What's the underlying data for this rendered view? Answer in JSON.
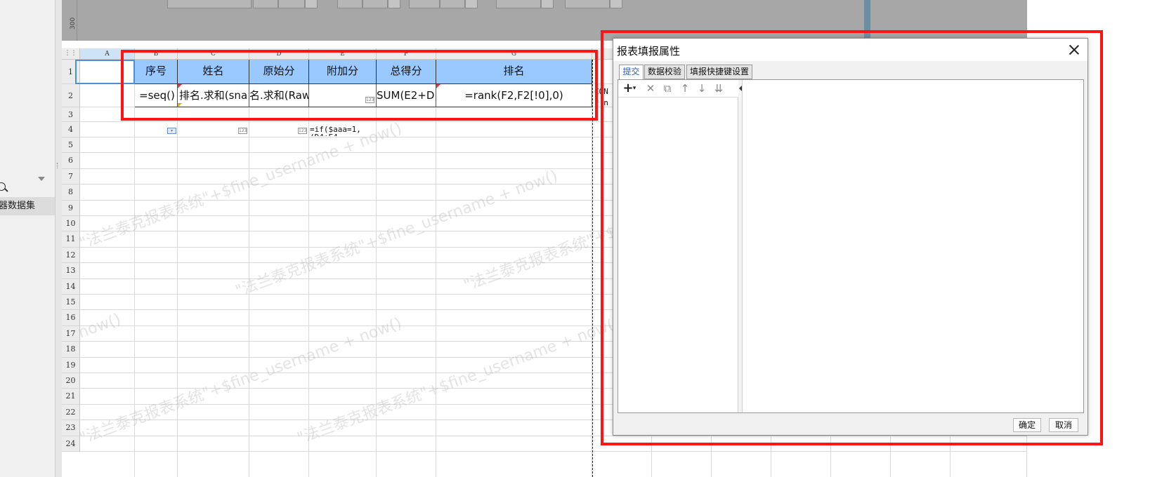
{
  "left_panel": {
    "dataset_label": "器数据集"
  },
  "toolbar_dim": {
    "ruler_label": "300"
  },
  "sheet": {
    "columns": [
      "A",
      "B",
      "C",
      "D",
      "E",
      "F",
      "G"
    ],
    "rows": [
      "1",
      "2",
      "3",
      "4",
      "5",
      "6",
      "7",
      "8",
      "9",
      "10",
      "11",
      "12",
      "13",
      "14",
      "15",
      "16",
      "17",
      "18",
      "19",
      "20",
      "21",
      "22",
      "23",
      "24"
    ],
    "header_row": [
      "序号",
      "姓名",
      "原始分",
      "附加分",
      "总得分",
      "排名"
    ],
    "formula_row": [
      "=seq()",
      "排名.求和(sna",
      "名.求和(Raw",
      "",
      "SUM(E2+D",
      "=rank(F2,F2[!0],0)"
    ],
    "row4_formula": "=if($aaa=1,",
    "row4_formula_line2": "  (D4+E4",
    "overflow_text_1": "CON",
    "overflow_text_2": "*.n",
    "cell_tag": "123",
    "watermarks": [
      "\"法兰泰克报表系统\"+$fine_username + now()",
      "\"法兰泰克报表系统\"+$fine_username + now()",
      "\"法兰泰克报表系统\"+$fine_username + now()",
      "\"法兰泰克报表系统\"+$fine_username + now()",
      "\"法兰泰克报表系统\"+$fine_username + now()",
      "now()"
    ]
  },
  "dialog": {
    "title": "报表填报属性",
    "tabs": [
      "提交",
      "数据校验",
      "填报快捷键设置"
    ],
    "active_tab": "提交",
    "toolbar": {
      "add": "+",
      "add_dropdown": "▾",
      "delete": "✕",
      "copy": "⧉",
      "move_up": "↑",
      "move_down": "↓",
      "move_bottom": "⇊"
    },
    "ok_label": "确定",
    "cancel_label": "取消"
  },
  "colors": {
    "header_fill": "#99c9ff",
    "highlight_red": "#ff1414",
    "selected_col": "#cfe3f6"
  }
}
